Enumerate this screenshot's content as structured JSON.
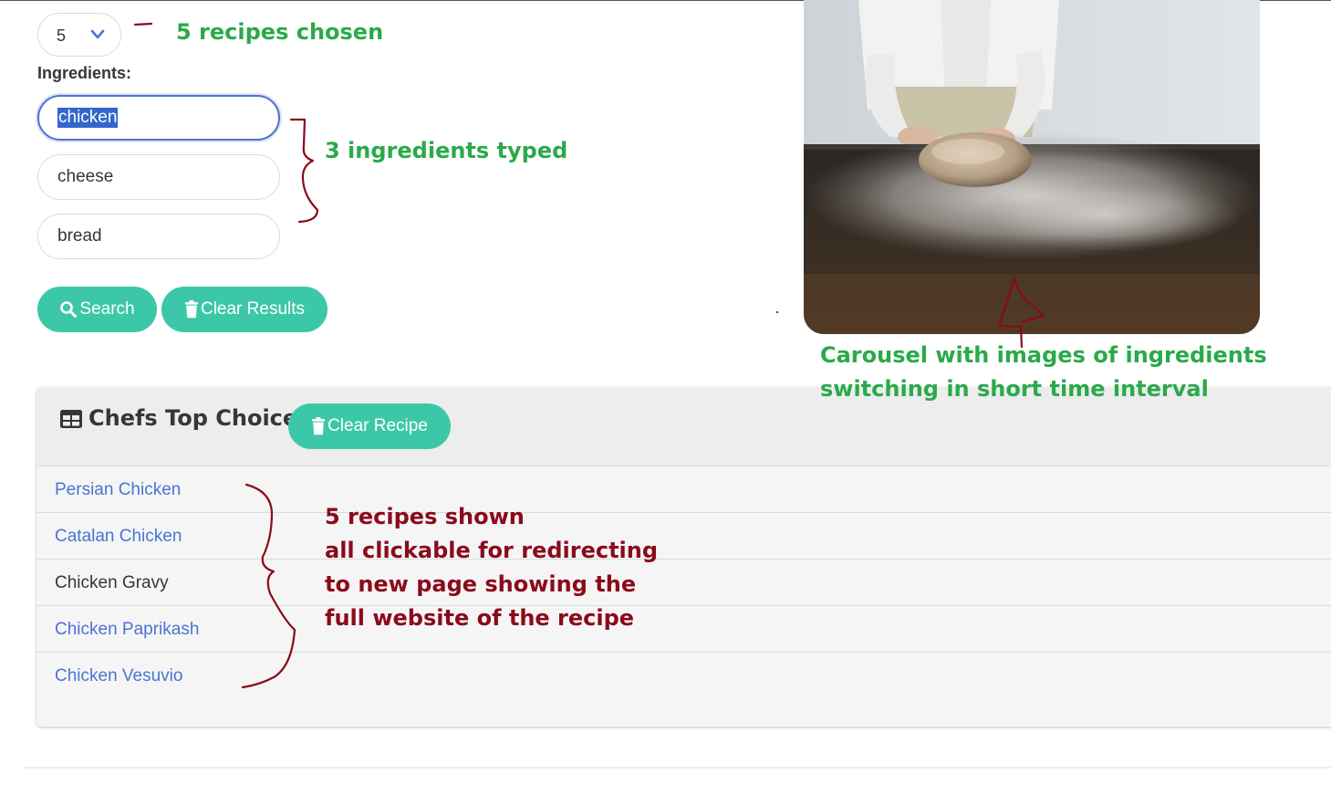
{
  "selector": {
    "value": "5"
  },
  "form": {
    "ingredients_label": "Ingredients:",
    "ingredients": [
      "chicken",
      "cheese",
      "bread"
    ],
    "search_label": "Search",
    "clear_results_label": "Clear Results"
  },
  "carousel": {
    "image": "chef-kneading-dough-photo"
  },
  "panel": {
    "title": "Chefs Top Choices",
    "clear_recipe_label": "Clear Recipe",
    "recipes": [
      {
        "name": "Persian Chicken",
        "style": "link"
      },
      {
        "name": "Catalan Chicken",
        "style": "link"
      },
      {
        "name": "Chicken Gravy",
        "style": "plain"
      },
      {
        "name": "Chicken Paprikash",
        "style": "link"
      },
      {
        "name": "Chicken Vesuvio",
        "style": "link"
      }
    ]
  },
  "annotations": {
    "recipes_chosen": "5 recipes chosen",
    "ingredients_typed": "3 ingredients typed",
    "carousel_line1": "Carousel with images of ingredients",
    "carousel_line2": "switching in short time interval",
    "recipes_shown": [
      "5 recipes shown",
      "all clickable for redirecting",
      "to new page showing the",
      "full website of the recipe"
    ]
  },
  "colors": {
    "accent": "#3cc8a8",
    "link": "#4a74d4",
    "annotation_green": "#2aaa4a",
    "annotation_red": "#8b0a1a"
  },
  "icons": [
    "chevron-down-icon",
    "search-icon",
    "trash-icon",
    "table-icon"
  ]
}
